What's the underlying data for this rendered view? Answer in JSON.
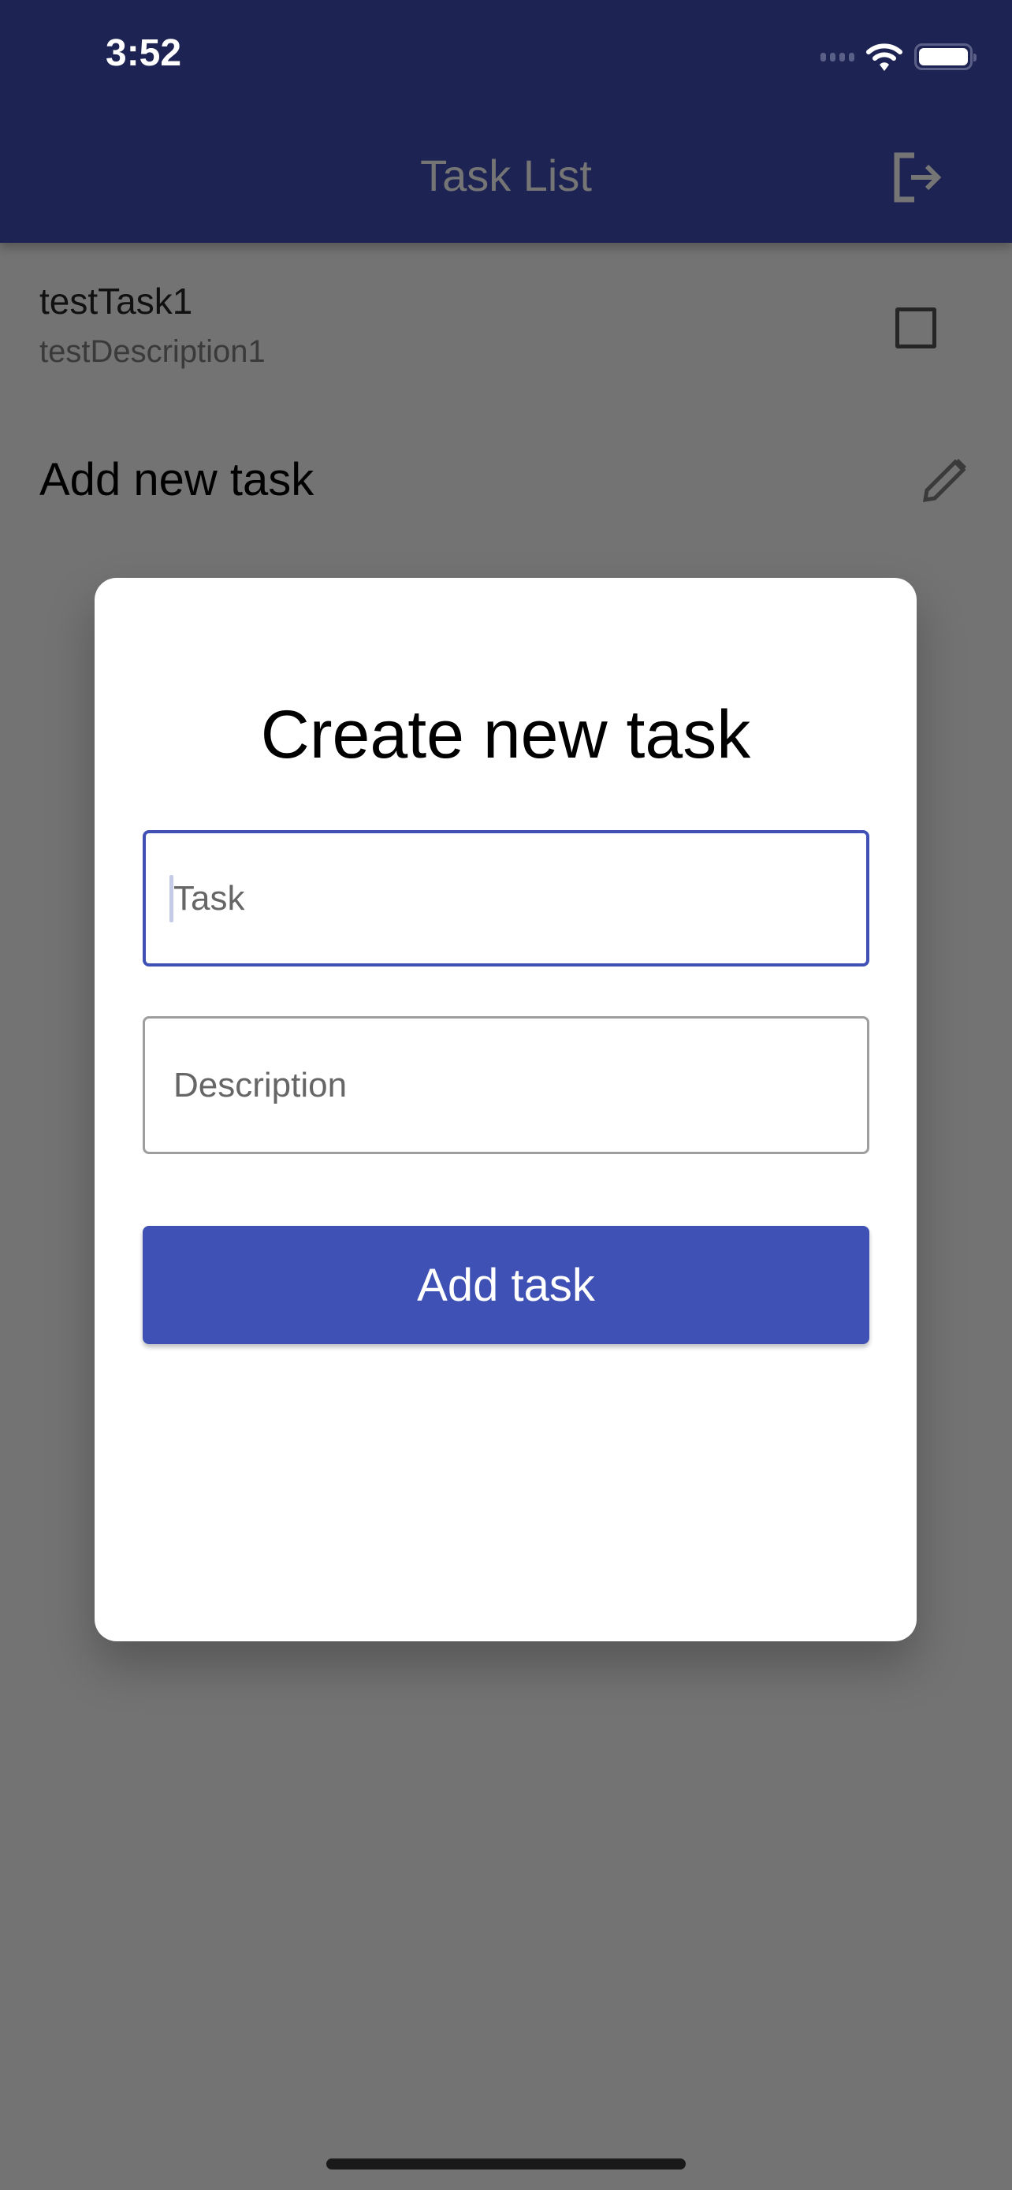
{
  "status_bar": {
    "time": "3:52",
    "icons": [
      "signal-icon",
      "wifi-icon",
      "battery-icon"
    ]
  },
  "app_bar": {
    "title": "Task List",
    "action_icon": "logout-icon",
    "color": "#1d2352"
  },
  "tasks": [
    {
      "title": "testTask1",
      "description": "testDescription1",
      "completed": false
    }
  ],
  "add_new": {
    "label": "Add new task",
    "icon": "pencil-icon"
  },
  "dialog": {
    "title": "Create new task",
    "task_field": {
      "placeholder": "Task",
      "value": ""
    },
    "description_field": {
      "placeholder": "Description",
      "value": ""
    },
    "submit_label": "Add task",
    "accent": "#3f51b5"
  }
}
